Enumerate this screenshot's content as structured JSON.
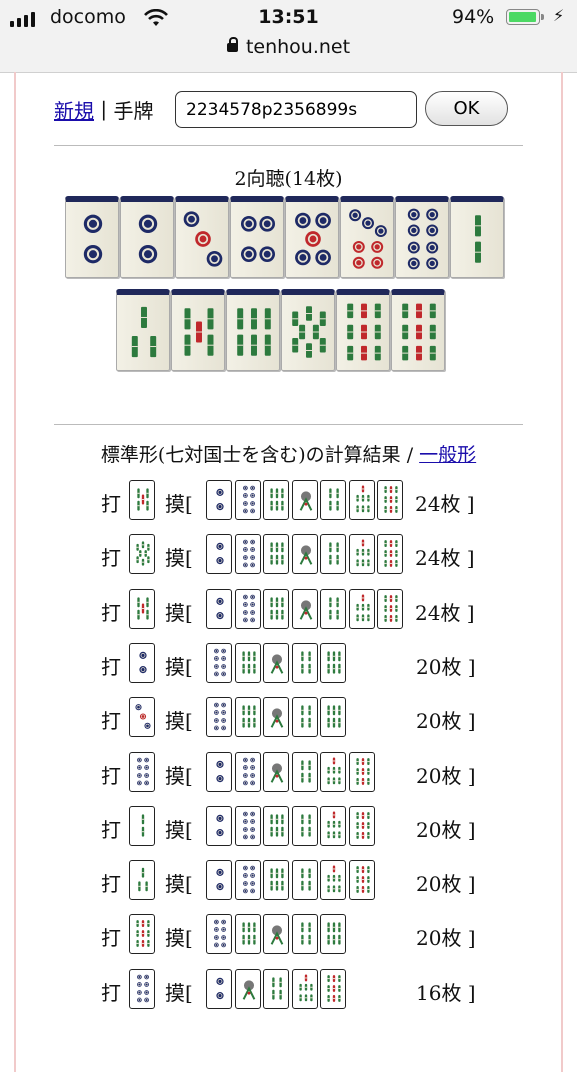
{
  "status_bar": {
    "carrier": "docomo",
    "time": "13:51",
    "battery": "94%"
  },
  "url_bar": {
    "domain": "tenhou.net"
  },
  "form": {
    "new_link": "新規",
    "separator": " | ",
    "hand_label": "手牌 ",
    "hand_value": "2234578p2356899s",
    "ok_label": "OK"
  },
  "result": {
    "shanten": "2向聴(14枚)"
  },
  "hand_tiles": [
    "2p",
    "2p",
    "3p",
    "4p",
    "5p",
    "7p",
    "8p",
    "2s",
    "3s",
    "5s",
    "6s",
    "8s",
    "9s",
    "9s"
  ],
  "calc": {
    "title": "標準形(七対国士を含む)の計算結果 / ",
    "alt_link": "一般形"
  },
  "labels": {
    "discard": "打",
    "draw": "摸[",
    "close": "]"
  },
  "suggestions": [
    {
      "discard": "5s",
      "draws": [
        "2p",
        "8p",
        "6s",
        "1s",
        "4s",
        "7s",
        "9s"
      ],
      "count": "24枚"
    },
    {
      "discard": "8s",
      "draws": [
        "2p",
        "8p",
        "6s",
        "1s",
        "4s",
        "7s",
        "9s"
      ],
      "count": "24枚"
    },
    {
      "discard": "5s",
      "draws": [
        "2p",
        "8p",
        "6s",
        "1s",
        "4s",
        "7s",
        "9s"
      ],
      "count": "24枚"
    },
    {
      "discard": "2p",
      "draws": [
        "8p",
        "6s",
        "1s",
        "4s",
        "6s"
      ],
      "count": "20枚"
    },
    {
      "discard": "3p",
      "draws": [
        "8p",
        "6s",
        "1s",
        "4s",
        "6s"
      ],
      "count": "20枚"
    },
    {
      "discard": "8p",
      "draws": [
        "2p",
        "8p",
        "1s",
        "4s",
        "7s",
        "9s"
      ],
      "count": "20枚"
    },
    {
      "discard": "2s",
      "draws": [
        "2p",
        "8p",
        "6s",
        "4s",
        "7s",
        "9s"
      ],
      "count": "20枚"
    },
    {
      "discard": "3s",
      "draws": [
        "2p",
        "8p",
        "6s",
        "4s",
        "7s",
        "9s"
      ],
      "count": "20枚"
    },
    {
      "discard": "9s",
      "draws": [
        "8p",
        "6s",
        "1s",
        "4s",
        "6s"
      ],
      "count": "20枚"
    },
    {
      "discard": "8p",
      "draws": [
        "2p",
        "1s",
        "4s",
        "7s",
        "9s"
      ],
      "count": "16枚"
    }
  ],
  "colors": {
    "link": "#1a0dab",
    "tile_back": "#20285a",
    "pin_red": "#c0282c",
    "pin_blue": "#1e2a66",
    "sou_green": "#2d7a3e",
    "sou_red": "#c0282c",
    "battery": "#4cd964"
  }
}
